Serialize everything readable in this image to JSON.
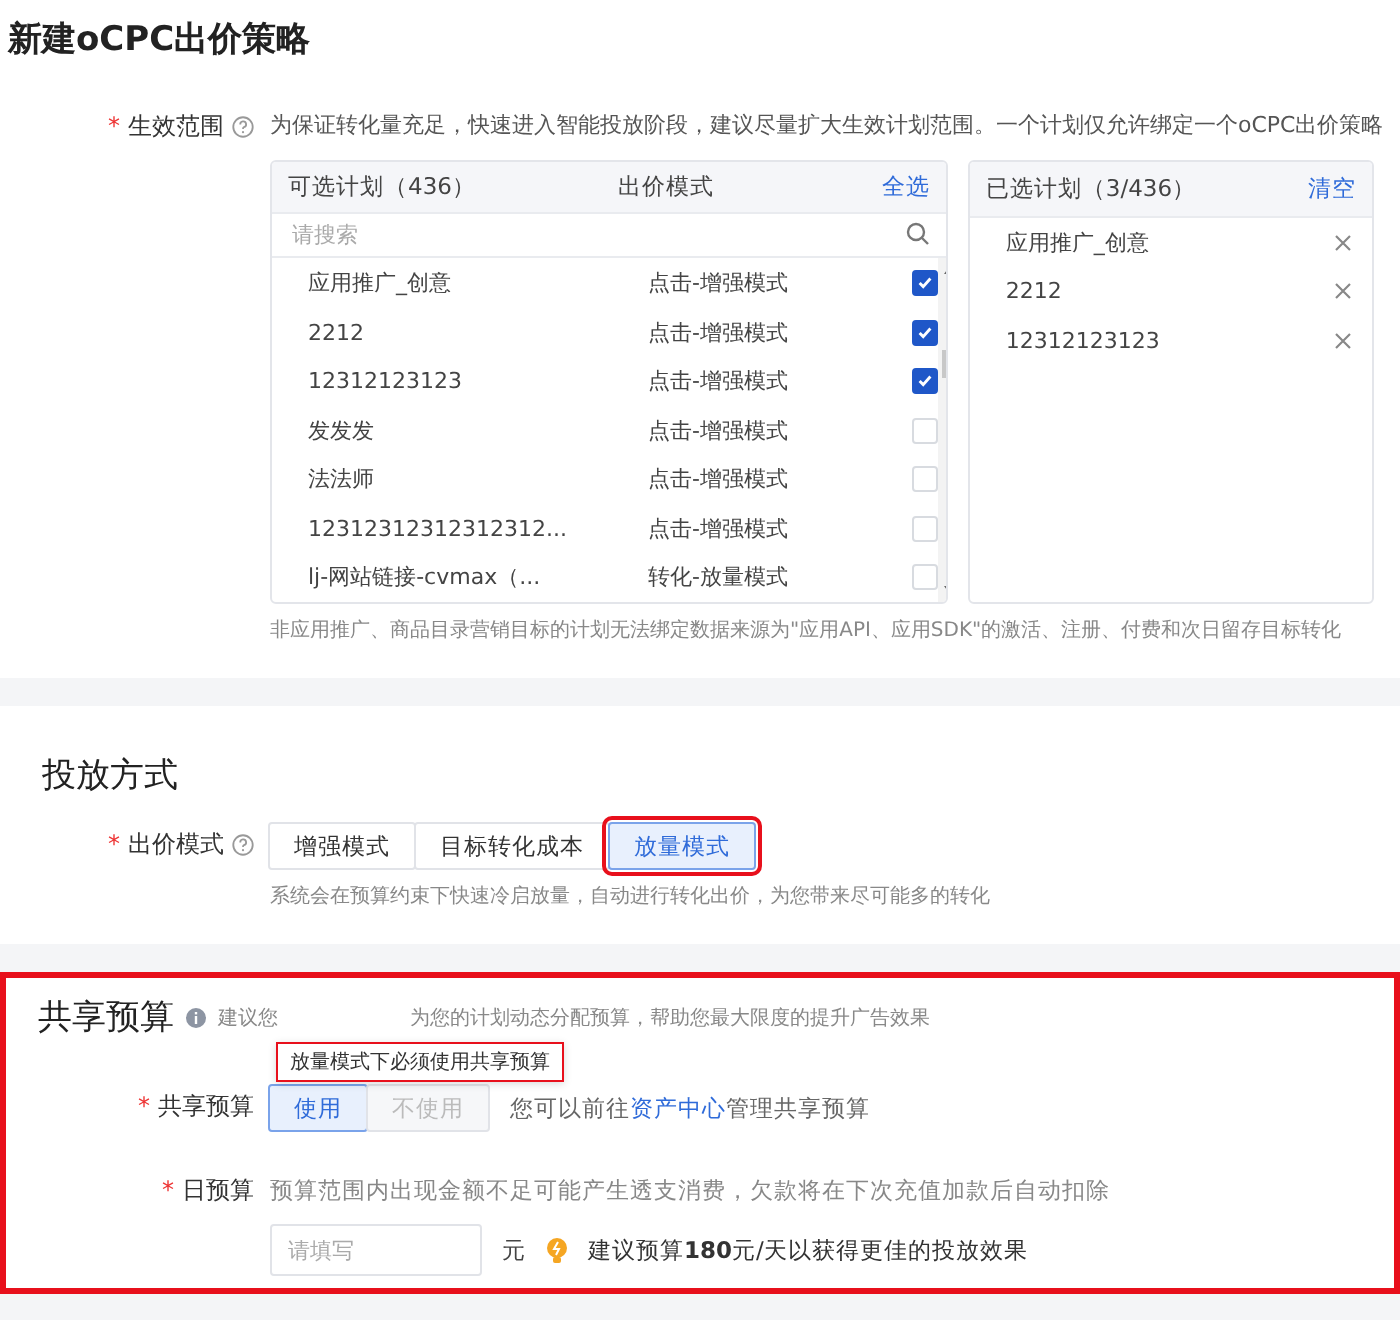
{
  "title": "新建oCPC出价策略",
  "scope": {
    "required": "*",
    "label": "生效范围",
    "hint": "为保证转化量充足，快速进入智能投放阶段，建议尽量扩大生效计划范围。一个计划仅允许绑定一个oCPC出价策略",
    "available": {
      "title": "可选计划（436）",
      "column": "出价模式",
      "action": "全选",
      "search_placeholder": "请搜索",
      "rows": [
        {
          "name": "应用推广_创意",
          "mode": "点击-增强模式",
          "checked": true
        },
        {
          "name": "2212",
          "mode": "点击-增强模式",
          "checked": true
        },
        {
          "name": "12312123123",
          "mode": "点击-增强模式",
          "checked": true
        },
        {
          "name": "发发发",
          "mode": "点击-增强模式",
          "checked": false
        },
        {
          "name": "法法师",
          "mode": "点击-增强模式",
          "checked": false
        },
        {
          "name": "12312312312312312...",
          "mode": "点击-增强模式",
          "checked": false
        },
        {
          "name": "lj-网站链接-cvmax（...",
          "mode": "转化-放量模式",
          "checked": false
        }
      ]
    },
    "chosen": {
      "title": "已选计划（3/436）",
      "action": "清空",
      "items": [
        "应用推广_创意",
        "2212",
        "12312123123"
      ]
    },
    "note": "非应用推广、商品目录营销目标的计划无法绑定数据来源为\"应用API、应用SDK\"的激活、注册、付费和次日留存目标转化"
  },
  "delivery": {
    "title": "投放方式",
    "required": "*",
    "label": "出价模式",
    "options": [
      {
        "label": "增强模式",
        "selected": false,
        "highlighted": false
      },
      {
        "label": "目标转化成本",
        "selected": false,
        "highlighted": false
      },
      {
        "label": "放量模式",
        "selected": true,
        "highlighted": true
      }
    ],
    "description": "系统会在预算约束下快速冷启放量，自动进行转化出价，为您带来尽可能多的转化"
  },
  "budget": {
    "title": "共享预算",
    "highlighted": true,
    "hint_start": "建议您",
    "hint_end": "为您的计划动态分配预算，帮助您最大限度的提升广告效果",
    "tooltip": "放量模式下必须使用共享预算",
    "share": {
      "required": "*",
      "label": "共享预算",
      "options": [
        {
          "label": "使用",
          "selected": true,
          "disabled": false
        },
        {
          "label": "不使用",
          "selected": false,
          "disabled": true
        }
      ],
      "note_before": "您可以前往",
      "link": "资产中心",
      "note_after": "管理共享预算"
    },
    "daily": {
      "required": "*",
      "label": "日预算",
      "hint": "预算范围内出现金额不足可能产生透支消费，欠款将在下次充值加款后自动扣除",
      "placeholder": "请填写",
      "unit": "元",
      "suggestion": "建议预算**180**元/天以获得更佳的投放效果"
    }
  }
}
